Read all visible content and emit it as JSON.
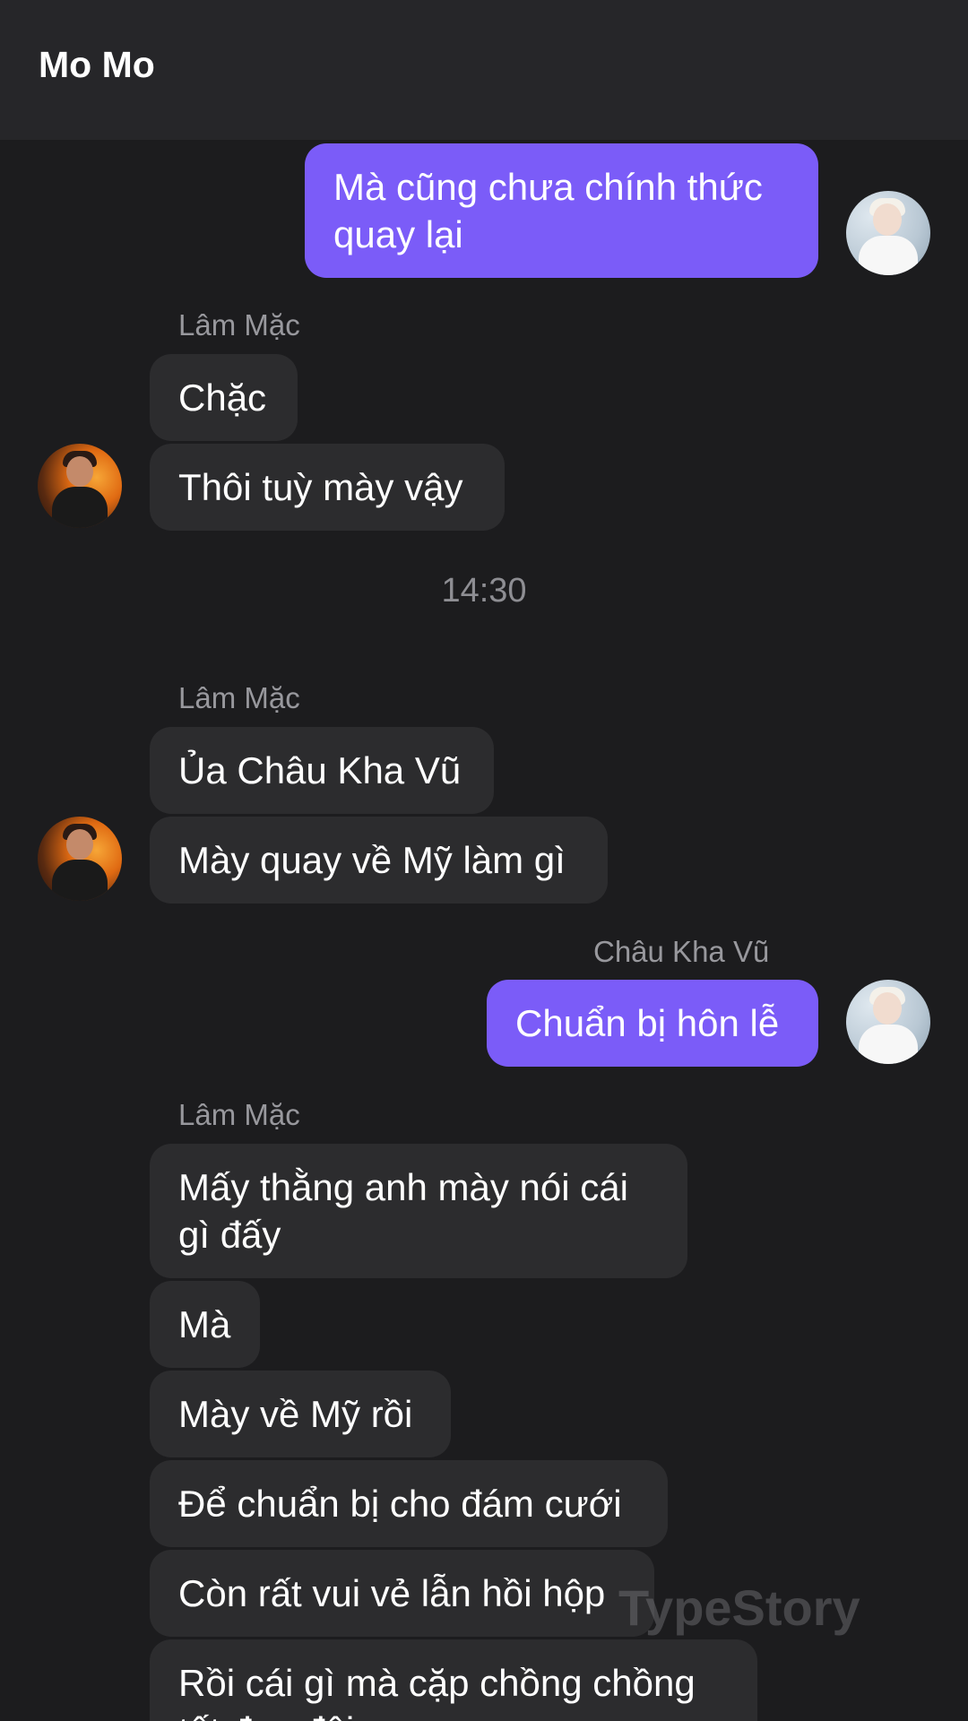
{
  "header": {
    "title": "Mo Mo"
  },
  "messages": {
    "m1": "Mà cũng chưa chính thức quay lại",
    "s1": "Lâm Mặc",
    "m2": "Chặc",
    "m3": "Thôi tuỳ mày vậy",
    "time1": "14:30",
    "s2": "Lâm Mặc",
    "m4": "Ủa Châu Kha Vũ",
    "m5": "Mày quay về Mỹ làm gì",
    "s3": "Châu Kha Vũ",
    "m6": "Chuẩn bị hôn lễ",
    "s4": "Lâm Mặc",
    "m7": "Mấy thằng anh mày nói cái gì đấy",
    "m8": "Mà",
    "m9": "Mày về Mỹ rồi",
    "m10": "Để chuẩn bị cho đám cưới",
    "m11": "Còn rất vui vẻ lẫn hồi hộp",
    "m12": "Rồi cái gì mà cặp chồng chồng tốt đẹp đôi"
  },
  "watermark": "TypeStory",
  "colors": {
    "background": "#1c1c1e",
    "header": "#262629",
    "incoming_bubble": "#2c2c2e",
    "outgoing_bubble": "#7b5cf8",
    "sender_text": "#98989d"
  }
}
